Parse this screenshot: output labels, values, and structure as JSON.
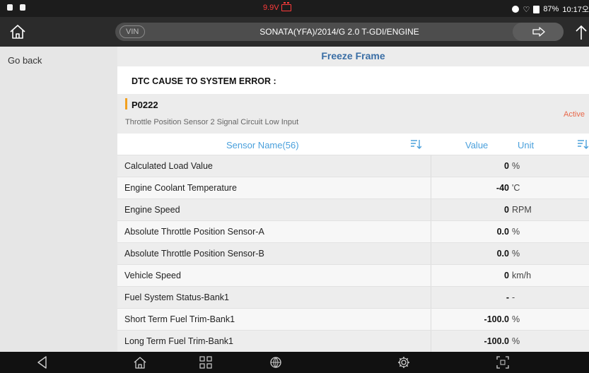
{
  "status_bar": {
    "voltage": "9.9V",
    "battery": "87%",
    "time": "10:17",
    "time_suffix": "오"
  },
  "header": {
    "vin_label": "VIN",
    "vehicle_path": "SONATA(YFA)/2014/G 2.0 T-GDI/ENGINE"
  },
  "sidebar": {
    "go_back": "Go back"
  },
  "page": {
    "title": "Freeze Frame"
  },
  "dtc": {
    "heading": "DTC CAUSE TO SYSTEM ERROR :",
    "code": "P0222",
    "description": "Throttle Position Sensor 2 Signal Circuit Low Input",
    "status": "Active",
    "accent_color": "#f2a01f",
    "status_color": "#e8684a"
  },
  "table": {
    "columns": {
      "name": "Sensor Name(56)",
      "value": "Value",
      "unit": "Unit"
    },
    "header_color": "#4aa0dc",
    "rows": [
      {
        "name": "Calculated Load Value",
        "value": "0",
        "unit": "%"
      },
      {
        "name": "Engine Coolant Temperature",
        "value": "-40",
        "unit": "'C"
      },
      {
        "name": "Engine Speed",
        "value": "0",
        "unit": "RPM"
      },
      {
        "name": "Absolute Throttle Position Sensor-A",
        "value": "0.0",
        "unit": "%"
      },
      {
        "name": "Absolute Throttle Position Sensor-B",
        "value": "0.0",
        "unit": "%"
      },
      {
        "name": "Vehicle Speed",
        "value": "0",
        "unit": "km/h"
      },
      {
        "name": "Fuel System Status-Bank1",
        "value": "-",
        "unit": "-"
      },
      {
        "name": "Short Term Fuel Trim-Bank1",
        "value": "-100.0",
        "unit": "%"
      },
      {
        "name": "Long Term Fuel Trim-Bank1",
        "value": "-100.0",
        "unit": "%"
      }
    ]
  },
  "icons": {
    "home": "home-icon",
    "forward": "arrow-right-icon",
    "upload": "arrow-up-icon",
    "sort": "sort-icon",
    "nav_back": "back-triangle-icon",
    "nav_home": "home-icon",
    "nav_apps": "grid-icon",
    "nav_browser": "globe-icon",
    "nav_settings": "gear-icon",
    "nav_screenshot": "screenshot-icon"
  }
}
